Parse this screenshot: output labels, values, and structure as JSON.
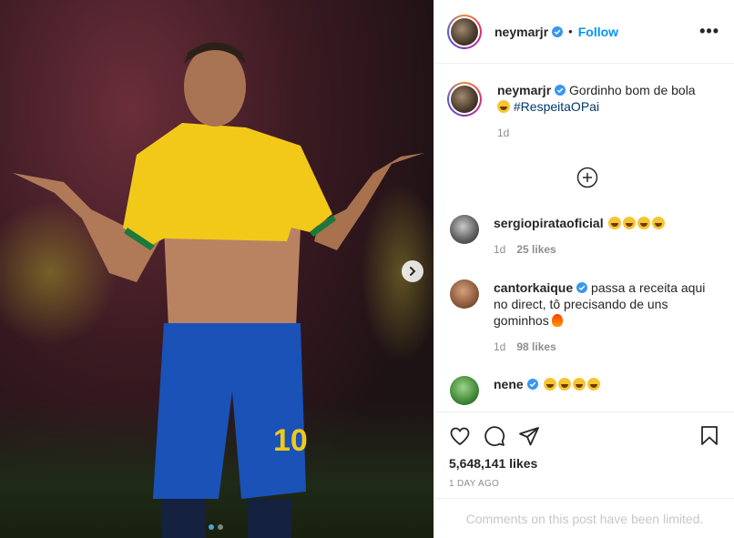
{
  "post": {
    "photo": {
      "description_icon": "photo",
      "carousel_dots": 2,
      "active_dot": 1
    }
  },
  "header": {
    "username": "neymarjr",
    "separator": "•",
    "follow_label": "Follow",
    "more_icon": "more-horizontal-icon"
  },
  "caption": {
    "username": "neymarjr",
    "text": "Gordinho bom de bola",
    "hashtag": "#RespeitaOPai",
    "time": "1d"
  },
  "comments": [
    {
      "username": "sergiopirataoficial",
      "verified": false,
      "text": "",
      "emoji_count": 4,
      "time": "1d",
      "likes": "25 likes"
    },
    {
      "username": "cantorkaique",
      "verified": true,
      "text": "passa a receita aqui no direct, tô precisando de uns gominhos",
      "time": "1d",
      "likes": "98 likes"
    },
    {
      "username": "nene",
      "verified": true,
      "text": "",
      "emoji_count": 4
    }
  ],
  "actions": {
    "like_count": "5,648,141 likes",
    "age": "1 DAY AGO"
  },
  "footer": {
    "limited_text": "Comments on this post have been limited."
  },
  "colors": {
    "link_blue": "#0095f6",
    "hashtag": "#00376b",
    "muted": "#8e8e8e"
  }
}
